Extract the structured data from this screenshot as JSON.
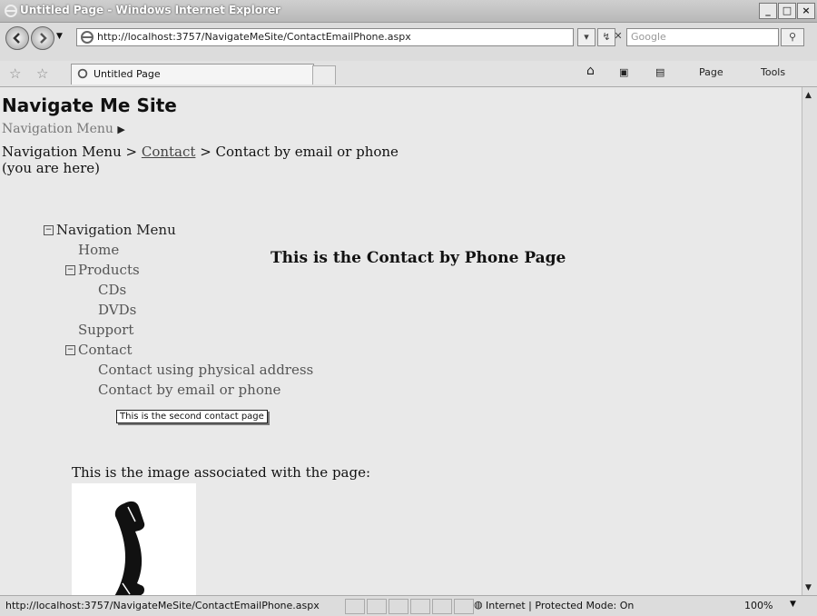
{
  "window": {
    "title": "Untitled Page - Windows Internet Explorer"
  },
  "address_bar": {
    "url": "http://localhost:3757/NavigateMeSite/ContactEmailPhone.aspx",
    "search_placeholder": "Google"
  },
  "tab": {
    "label": "Untitled Page"
  },
  "command_bar": {
    "page_label": "Page",
    "tools_label": "Tools"
  },
  "page": {
    "site_title": "Navigate Me Site",
    "nav_menu_label": "Navigation Menu",
    "breadcrumb": {
      "root": "Navigation Menu",
      "sep1": " > ",
      "link": "Contact",
      "sep2": " > ",
      "current": "Contact by email or phone (you are here)"
    },
    "tree": {
      "root": "Navigation Menu",
      "items": {
        "home": "Home",
        "products": "Products",
        "cds": "CDs",
        "dvds": "DVDs",
        "support": "Support",
        "contact": "Contact",
        "contact_physical": "Contact using physical address",
        "contact_email": "Contact by email or phone"
      }
    },
    "tooltip": "This is the second contact page",
    "heading": "This is the Contact by Phone Page",
    "image_label": "This is the image associated with the page:"
  },
  "status_bar": {
    "url": "http://localhost:3757/NavigateMeSite/ContactEmailPhone.aspx",
    "zone": "Internet | Protected Mode: On",
    "zoom": "100%"
  },
  "icons": {
    "back": "back-arrow-icon",
    "forward": "forward-arrow-icon",
    "refresh": "refresh-icon",
    "stop": "stop-icon",
    "search": "search-icon",
    "favorites": "star-icon",
    "add_favorite": "add-star-icon",
    "home": "home-icon",
    "feeds": "rss-icon",
    "print": "printer-icon",
    "globe": "globe-icon",
    "phone": "phone-handset-icon"
  }
}
